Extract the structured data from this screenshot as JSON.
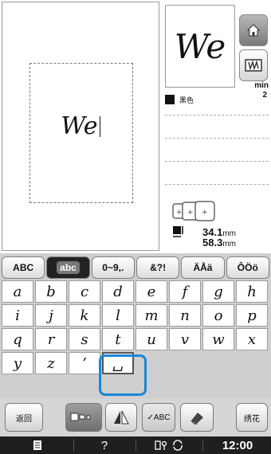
{
  "edit": {
    "text": "We"
  },
  "preview": {
    "text": "We"
  },
  "thread": {
    "color_name": "黑色",
    "color_hex": "#111111"
  },
  "time_info": {
    "label": "min",
    "value": "2"
  },
  "size": {
    "width": "34.1",
    "height": "58.3",
    "unit": "mm"
  },
  "tabs": [
    {
      "label": "ABC",
      "active": false
    },
    {
      "label": "abc",
      "active": true
    },
    {
      "label": "0~9,.",
      "active": false
    },
    {
      "label": "&?!",
      "active": false
    },
    {
      "label": "ÄÅä",
      "active": false
    },
    {
      "label": "ÔÖö",
      "active": false
    }
  ],
  "keyboard": {
    "rows": [
      [
        "a",
        "b",
        "c",
        "d",
        "e",
        "f",
        "g",
        "h"
      ],
      [
        "i",
        "j",
        "k",
        "l",
        "m",
        "n",
        "o",
        "p"
      ],
      [
        "q",
        "r",
        "s",
        "t",
        "u",
        "v",
        "w",
        "x"
      ],
      [
        "y",
        "z",
        "’",
        "␣"
      ]
    ]
  },
  "toolbar": {
    "back_label": "返回",
    "check_label": "✓ABC",
    "embroider_label": "绣花"
  },
  "status": {
    "help": "?",
    "time": "12:00"
  }
}
